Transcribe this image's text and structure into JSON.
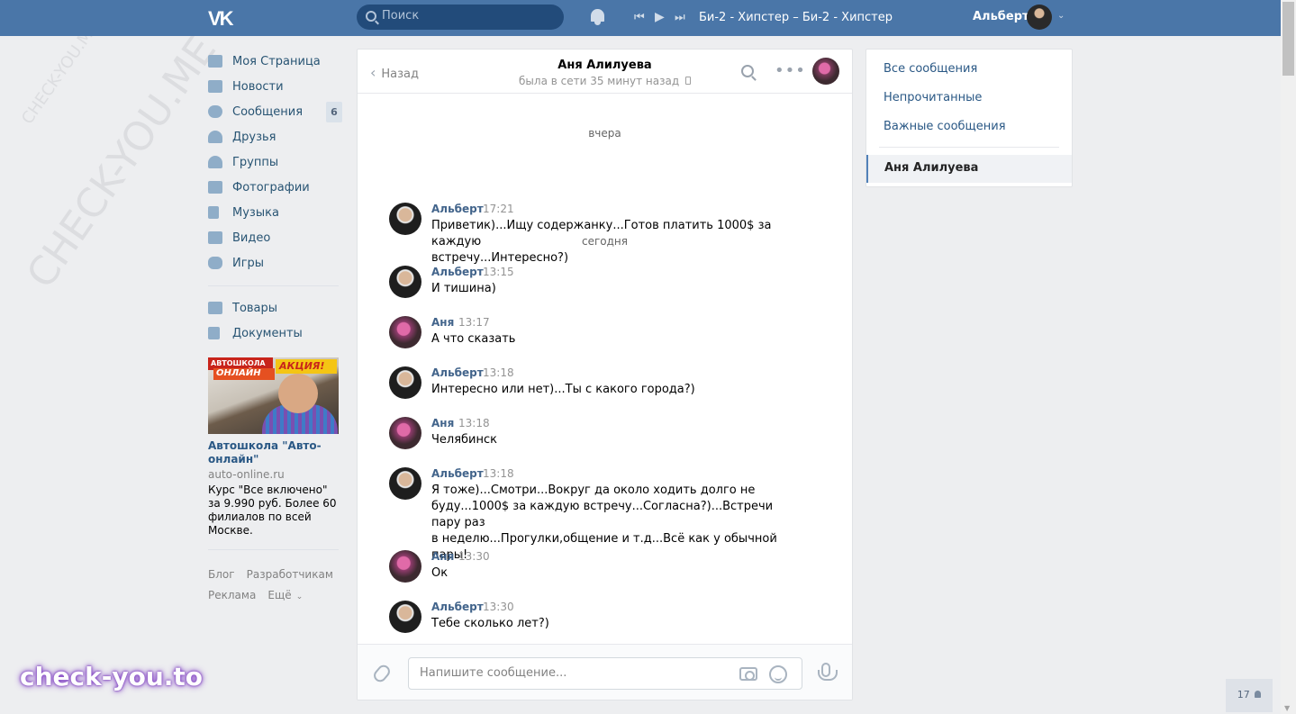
{
  "topbar": {
    "logo": "VK",
    "search_placeholder": "Поиск",
    "player": {
      "prev": "⏮",
      "play": "▶",
      "next": "⏭",
      "track": "Би-2 - Хипстер – Би-2 - Хипстер"
    },
    "user_name": "Альберт"
  },
  "watermark": [
    "CHECK-YOU.ME",
    "CHECK-YOU.ME"
  ],
  "sidebar": {
    "items": [
      {
        "label": "Моя Страница",
        "icon": "home-icon"
      },
      {
        "label": "Новости",
        "icon": "news-icon"
      },
      {
        "label": "Сообщения",
        "icon": "messages-icon",
        "badge": "6"
      },
      {
        "label": "Друзья",
        "icon": "friends-icon"
      },
      {
        "label": "Группы",
        "icon": "groups-icon"
      },
      {
        "label": "Фотографии",
        "icon": "camera-icon"
      },
      {
        "label": "Музыка",
        "icon": "music-icon"
      },
      {
        "label": "Видео",
        "icon": "video-icon"
      },
      {
        "label": "Игры",
        "icon": "games-icon"
      }
    ],
    "items2": [
      {
        "label": "Товары",
        "icon": "bag-icon"
      },
      {
        "label": "Документы",
        "icon": "document-icon"
      }
    ]
  },
  "ad": {
    "banner_line1": "АВТОШКОЛА",
    "banner_line2": "ОНЛАЙН",
    "banner_promo": "АКЦИЯ!",
    "title": "Автошкола \"Авто-онлайн\"",
    "domain": "auto-online.ru",
    "text": "Курс \"Все включено\" за 9.990 руб. Более 60 филиалов по всей Москве."
  },
  "footer": {
    "blog": "Блог",
    "dev": "Разработчикам",
    "ads": "Реклама",
    "more": "Ещё"
  },
  "chat": {
    "back_label": "Назад",
    "title": "Аня Алилуева",
    "status": "была в сети 35 минут назад",
    "days": [
      "вчера",
      "сегодня"
    ],
    "messages": [
      {
        "author": "Альберт",
        "time": "17:21",
        "text": "Приветик)...Ищу содержанку...Готов платить 1000$ за каждую\nвстречу...Интересно?)"
      },
      {
        "author": "Альберт",
        "time": "13:15",
        "text": "И тишина)"
      },
      {
        "author": "Аня",
        "time": "13:17",
        "text": "А что сказать"
      },
      {
        "author": "Альберт",
        "time": "13:18",
        "text": "Интересно или нет)...Ты с какого города?)"
      },
      {
        "author": "Аня",
        "time": "13:18",
        "text": "Челябинск"
      },
      {
        "author": "Альберт",
        "time": "13:18",
        "text": "Я тоже)...Смотри...Вокруг да около ходить долго не\nбуду...1000$ за каждую встречу...Согласна?)...Встречи пару раз\nв неделю...Прогулки,общение и т.д...Всё как у обычной пары!"
      },
      {
        "author": "Аня",
        "time": "13:30",
        "text": "Ок"
      },
      {
        "author": "Альберт",
        "time": "13:30",
        "text": "Тебе сколько лет?)"
      }
    ],
    "input_placeholder": "Напишите сообщение..."
  },
  "right_panel": {
    "all": "Все сообщения",
    "unread": "Непрочитанные",
    "important": "Важные сообщения",
    "active": "Аня Алилуева"
  },
  "online_count": "17",
  "brand_watermark": "check-you.to"
}
